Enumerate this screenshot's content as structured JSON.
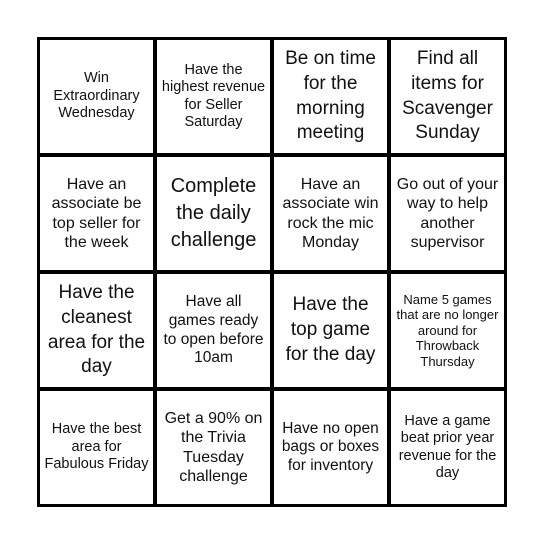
{
  "board": {
    "cells": [
      "Win Extraordinary Wednesday",
      "Have the highest revenue for Seller Saturday",
      "Be on time for the morning meeting",
      "Find all items for Scavenger Sunday",
      "Have an associate be top seller for the week",
      "Complete the daily challenge",
      "Have an associate win rock the mic Monday",
      "Go out of your way to help another supervisor",
      "Have the cleanest area for the day",
      "Have all games ready to open before 10am",
      "Have the top game for the day",
      "Name 5 games that are no longer around for Throwback Thursday",
      "Have the best area for Fabulous Friday",
      "Get a 90% on the Trivia Tuesday challenge",
      "Have no open bags or boxes for inventory",
      "Have a game beat prior year revenue for the day"
    ]
  }
}
